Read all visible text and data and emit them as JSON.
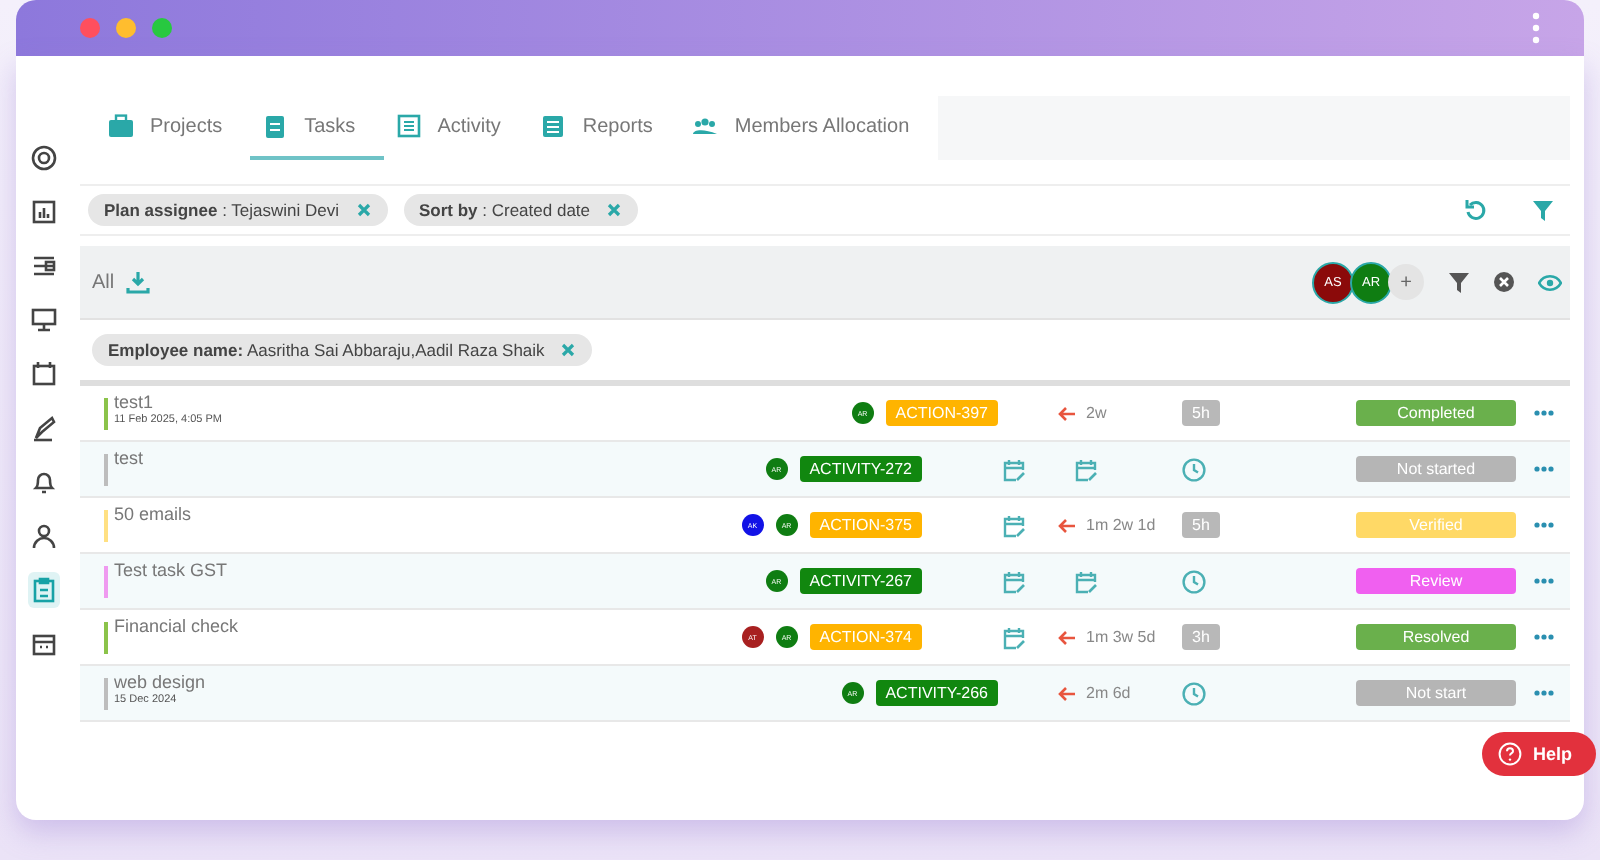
{
  "sidebar": {
    "items": [
      {
        "selected": false
      },
      {
        "selected": false
      },
      {
        "selected": false
      },
      {
        "selected": false
      },
      {
        "selected": false
      },
      {
        "selected": false
      },
      {
        "selected": false
      },
      {
        "selected": false
      },
      {
        "selected": true
      },
      {
        "selected": false
      }
    ]
  },
  "tabs": [
    {
      "label": "Projects",
      "selected": false
    },
    {
      "label": "Tasks",
      "selected": true
    },
    {
      "label": "Activity",
      "selected": false
    },
    {
      "label": "Reports",
      "selected": false
    },
    {
      "label": "Members Allocation",
      "selected": false
    }
  ],
  "filters": [
    "**Plan assignee** : Tejaswini Devi",
    "**Sort by** : Created date"
  ],
  "toolbar": {
    "label": "All",
    "avatars": [
      {
        "initials": "AS",
        "color": "#8b0a0a"
      },
      {
        "initials": "AR",
        "color": "#0f7d12"
      }
    ],
    "add": "+"
  },
  "employee_filter": "**Employee name:**  Aasritha Sai Abbaraju,Aadil Raza Shaik",
  "rows": [
    {
      "name": "test1",
      "date": "11 Feb 2025, 4:05 PM",
      "color": "#8bc34a",
      "avatars": [
        {
          "initials": "AR",
          "color": "#0f7d12"
        }
      ],
      "tag": {
        "text": "ACTION-397",
        "kind": "action"
      },
      "start": {
        "kind": "none"
      },
      "due": {
        "kind": "overdue",
        "text": "2w"
      },
      "estimate": {
        "kind": "hours",
        "text": "5h"
      },
      "status": {
        "text": "Completed",
        "color": "#6ab04c"
      }
    },
    {
      "name": "test",
      "color": "#bdbdbd",
      "avatars": [
        {
          "initials": "AR",
          "color": "#0f7d12"
        }
      ],
      "tag": {
        "text": "ACTIVITY-272",
        "kind": "activity"
      },
      "start": {
        "kind": "calendar"
      },
      "due": {
        "kind": "calendar"
      },
      "estimate": {
        "kind": "clock"
      },
      "status": {
        "text": "Not started",
        "color": "#b5b5b5"
      }
    },
    {
      "name": "50 emails",
      "color": "#ffe082",
      "avatars": [
        {
          "initials": "AK",
          "color": "#1212e6"
        },
        {
          "initials": "AR",
          "color": "#0f7d12"
        }
      ],
      "tag": {
        "text": "ACTION-375",
        "kind": "action"
      },
      "start": {
        "kind": "calendar"
      },
      "due": {
        "kind": "overdue",
        "text": "1m 2w 1d"
      },
      "estimate": {
        "kind": "hours",
        "text": "5h"
      },
      "status": {
        "text": "Verified",
        "color": "#ffd966"
      }
    },
    {
      "name": "Test task GST",
      "color": "#ef9af0",
      "avatars": [
        {
          "initials": "AR",
          "color": "#0f7d12"
        }
      ],
      "tag": {
        "text": "ACTIVITY-267",
        "kind": "activity"
      },
      "start": {
        "kind": "calendar"
      },
      "due": {
        "kind": "calendar"
      },
      "estimate": {
        "kind": "clock"
      },
      "status": {
        "text": "Review",
        "color": "#f060f0"
      }
    },
    {
      "name": "Financial check",
      "color": "#8bc34a",
      "avatars": [
        {
          "initials": "AT",
          "color": "#a82020"
        },
        {
          "initials": "AR",
          "color": "#0f7d12"
        }
      ],
      "tag": {
        "text": "ACTION-374",
        "kind": "action"
      },
      "start": {
        "kind": "calendar"
      },
      "due": {
        "kind": "overdue",
        "text": "1m 3w 5d"
      },
      "estimate": {
        "kind": "hours",
        "text": "3h"
      },
      "status": {
        "text": "Resolved",
        "color": "#6ab04c"
      }
    },
    {
      "name": "web design",
      "date": "15 Dec 2024",
      "color": "#bdbdbd",
      "avatars": [
        {
          "initials": "AR",
          "color": "#0f7d12"
        }
      ],
      "tag": {
        "text": "ACTIVITY-266",
        "kind": "activity"
      },
      "start": {
        "kind": "none"
      },
      "due": {
        "kind": "overdue",
        "text": "2m 6d"
      },
      "estimate": {
        "kind": "clock"
      },
      "status": {
        "text": "Not start",
        "color": "#b5b5b5"
      }
    }
  ],
  "help": "Help"
}
